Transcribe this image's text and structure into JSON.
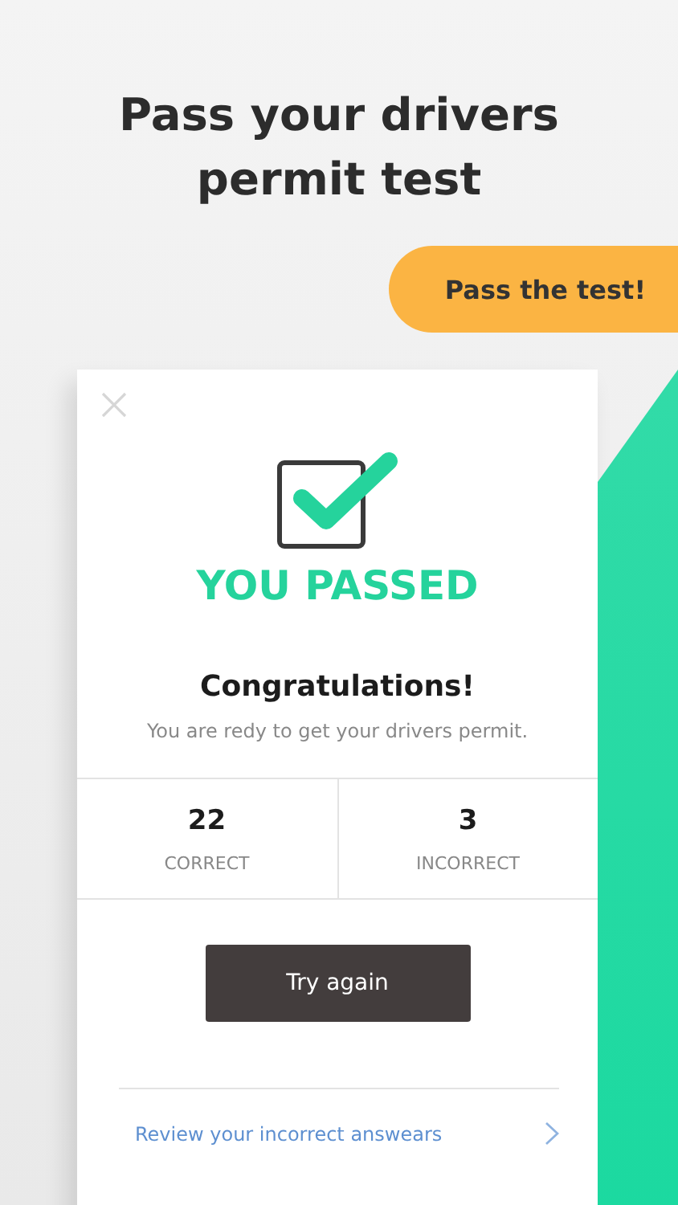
{
  "headline": "Pass your drivers permit test",
  "badge": "Pass the test!",
  "result": {
    "title": "YOU PASSED",
    "heading": "Congratulations!",
    "message": "You are redy to get your drivers permit.",
    "stats": [
      {
        "value": "22",
        "label": "CORRECT"
      },
      {
        "value": "3",
        "label": "INCORRECT"
      }
    ],
    "button": "Try again",
    "link": "Review your incorrect answears"
  }
}
